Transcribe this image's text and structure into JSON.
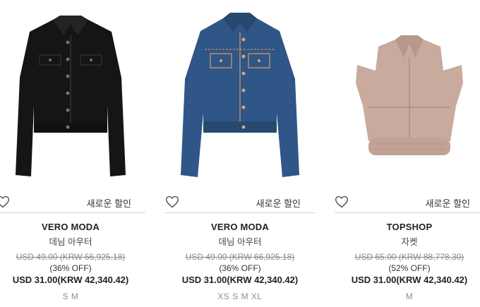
{
  "colors": {
    "jacket_black": "#151515",
    "jacket_denim": "#2f5686",
    "jacket_tan": "#c8ab9d",
    "divider": "#cfcfcf",
    "muted_text": "#8a8a8a"
  },
  "products": [
    {
      "brand": "VERO MODA",
      "category": "데님 아우터",
      "original_price": "USD 49.00 (KRW 66,925.18)",
      "discount": "(36% OFF)",
      "price": "USD 31.00(KRW 42,340.42)",
      "sizes": "S M",
      "sale_label": "새로운 할인",
      "wishlist_icon": "heart-outline-icon"
    },
    {
      "brand": "VERO MODA",
      "category": "데님 아우터",
      "original_price": "USD 49.00 (KRW 66,925.18)",
      "discount": "(36% OFF)",
      "price": "USD 31.00(KRW 42,340.42)",
      "sizes": "XS S M XL",
      "sale_label": "새로운 할인",
      "wishlist_icon": "heart-outline-icon"
    },
    {
      "brand": "TOPSHOP",
      "category": "자켓",
      "original_price": "USD 65.00 (KRW 88,778.30)",
      "discount": "(52% OFF)",
      "price": "USD 31.00(KRW 42,340.42)",
      "sizes": "M",
      "sale_label": "새로운 할인",
      "wishlist_icon": "heart-outline-icon"
    }
  ]
}
